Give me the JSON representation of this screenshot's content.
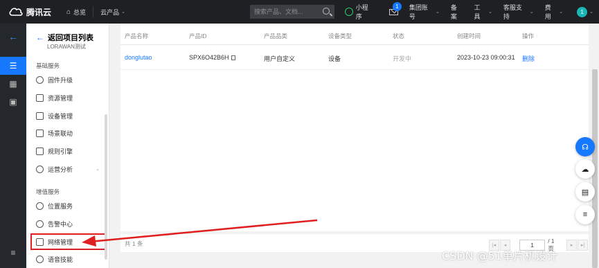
{
  "topbar": {
    "brand": "腾讯云",
    "overview": "总览",
    "cloud_products": "云产品",
    "search_placeholder": "搜索产品、文档...",
    "mini_program": "小程序",
    "mail_badge": "1",
    "group_account": "集团账号",
    "beian": "备案",
    "tools": "工具",
    "support": "客服支持",
    "billing": "费用",
    "avatar": "1"
  },
  "sidebar": {
    "back_label": "返回项目列表",
    "project_name": "LORAWAN测试",
    "groups": [
      {
        "title": "基础服务",
        "items": [
          {
            "label": "固件升级",
            "icon": "firmware-icon"
          },
          {
            "label": "资源管理",
            "icon": "resource-icon"
          },
          {
            "label": "设备管理",
            "icon": "device-icon"
          },
          {
            "label": "场景联动",
            "icon": "scene-icon"
          },
          {
            "label": "规则引擎",
            "icon": "rule-engine-icon"
          },
          {
            "label": "运营分析",
            "icon": "analytics-icon"
          }
        ]
      },
      {
        "title": "增值服务",
        "items": [
          {
            "label": "位置服务",
            "icon": "location-icon"
          },
          {
            "label": "告警中心",
            "icon": "alarm-icon"
          },
          {
            "label": "网络管理",
            "icon": "network-icon"
          },
          {
            "label": "语音技能",
            "icon": "voice-icon"
          }
        ]
      }
    ]
  },
  "table": {
    "headers": [
      "产品名称",
      "产品ID",
      "产品品类",
      "设备类型",
      "状态",
      "创建时间",
      "操作"
    ],
    "rows": [
      {
        "name": "donglutao",
        "id": "SPX6O42B6H",
        "category": "用户自定义",
        "device_type": "设备",
        "status": "开发中",
        "created": "2023-10-23 09:00:31",
        "action": "删除"
      }
    ]
  },
  "footer": {
    "total": "共 1 条",
    "page": "1",
    "page_total": "/ 1 页"
  },
  "watermark": "CSDN @51单片机设计",
  "colors": {
    "accent": "#1677ff",
    "topbar": "#1e2023",
    "highlight": "#e02020"
  }
}
